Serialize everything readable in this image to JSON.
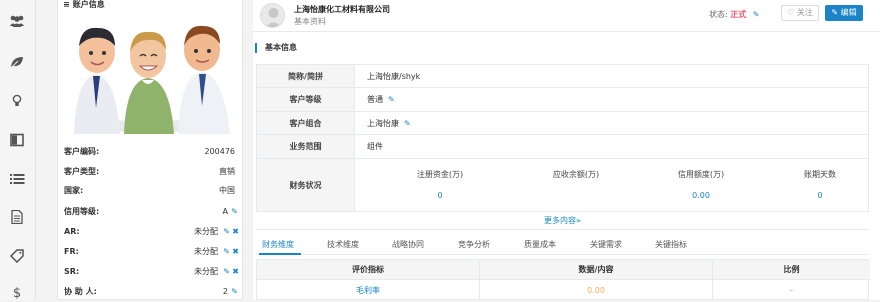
{
  "rail": {
    "icons": [
      "users-icon",
      "leaf-icon",
      "lightbulb-icon",
      "columns-icon",
      "list-icon",
      "document-icon",
      "tag-icon",
      "dollar-icon"
    ]
  },
  "account": {
    "panel_title": "账户信息",
    "fields": [
      {
        "label": "客户编码:",
        "value": "200476"
      },
      {
        "label": "客户类型:",
        "value": "直销"
      },
      {
        "label": "国家:",
        "value": "中国"
      },
      {
        "label": "信用等级:",
        "value": "A"
      },
      {
        "label": "AR:",
        "value": "未分配"
      },
      {
        "label": "FR:",
        "value": "未分配"
      },
      {
        "label": "SR:",
        "value": "未分配"
      },
      {
        "label": "协 助 人:",
        "value": "2"
      }
    ]
  },
  "header": {
    "company": "上海怡康化工材料有限公司",
    "subtitle": "基本资料",
    "status_label": "状态:",
    "status_value": "正式",
    "follow_label": "关注",
    "edit_label": "编辑"
  },
  "basic": {
    "section_title": "基本信息",
    "rows": [
      {
        "label": "简称/简拼",
        "value": "上海怡康/shyk"
      },
      {
        "label": "客户等级",
        "value": "普通"
      },
      {
        "label": "客户组合",
        "value": "上海怡康"
      },
      {
        "label": "业务范围",
        "value": "组件"
      }
    ],
    "finance_label": "财务状况",
    "finance": [
      {
        "header": "注册资金(万)",
        "value": "0"
      },
      {
        "header": "应收余额(万)",
        "value": ""
      },
      {
        "header": "信用额度(万)",
        "value": "0.00"
      },
      {
        "header": "账期天数",
        "value": "0"
      }
    ],
    "more": "更多内容»"
  },
  "tabs": [
    "财务维度",
    "技术维度",
    "战略协同",
    "竞争分析",
    "质量成本",
    "关键需求",
    "关键指标"
  ],
  "grid": {
    "headers": [
      "评价指标",
      "数据/内容",
      "比例"
    ],
    "rows": [
      {
        "metric": "毛利率",
        "data": "0.00",
        "ratio": "-"
      }
    ]
  },
  "colors": {
    "accent": "#1c84c6",
    "status": "#ed5565",
    "data_orange": "#f8ac59"
  }
}
